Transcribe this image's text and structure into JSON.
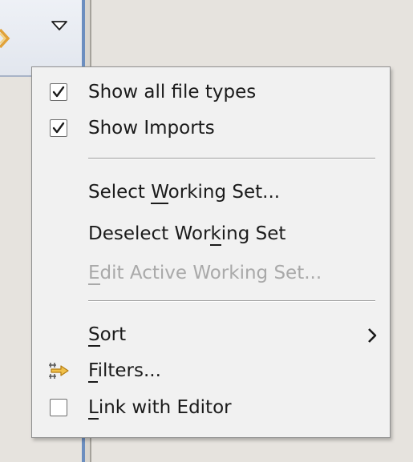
{
  "background": {
    "toolbar_sync_icon": "link-sync-icon",
    "view_menu_icon": "chevron-down-icon"
  },
  "menu": {
    "items": [
      {
        "label_pre": "Show all file types",
        "mnemonic": "",
        "label_post": "",
        "type": "check",
        "checked": true,
        "enabled": true
      },
      {
        "label_pre": "Show Imports",
        "mnemonic": "",
        "label_post": "",
        "type": "check",
        "checked": true,
        "enabled": true
      },
      {
        "label_pre": "Select ",
        "mnemonic": "W",
        "label_post": "orking Set...",
        "type": "action",
        "enabled": true
      },
      {
        "label_pre": "Deselect Wor",
        "mnemonic": "k",
        "label_post": "ing Set",
        "type": "action",
        "enabled": true
      },
      {
        "label_pre": "",
        "mnemonic": "E",
        "label_post": "dit Active Working Set...",
        "type": "action",
        "enabled": false
      },
      {
        "label_pre": "",
        "mnemonic": "S",
        "label_post": "ort",
        "type": "submenu",
        "enabled": true,
        "icon": "chevron-right-icon"
      },
      {
        "label_pre": "",
        "mnemonic": "F",
        "label_post": "ilters...",
        "type": "action",
        "enabled": true,
        "icon": "filters-icon"
      },
      {
        "label_pre": "",
        "mnemonic": "L",
        "label_post": "ink with Editor",
        "type": "check",
        "checked": false,
        "enabled": true
      }
    ]
  },
  "colors": {
    "menu_bg": "#f1f1f1",
    "text": "#1b1b1b",
    "disabled_text": "#a9a9a9",
    "view_border": "#6c8ebf",
    "icon_accent": "#e1a23a"
  }
}
